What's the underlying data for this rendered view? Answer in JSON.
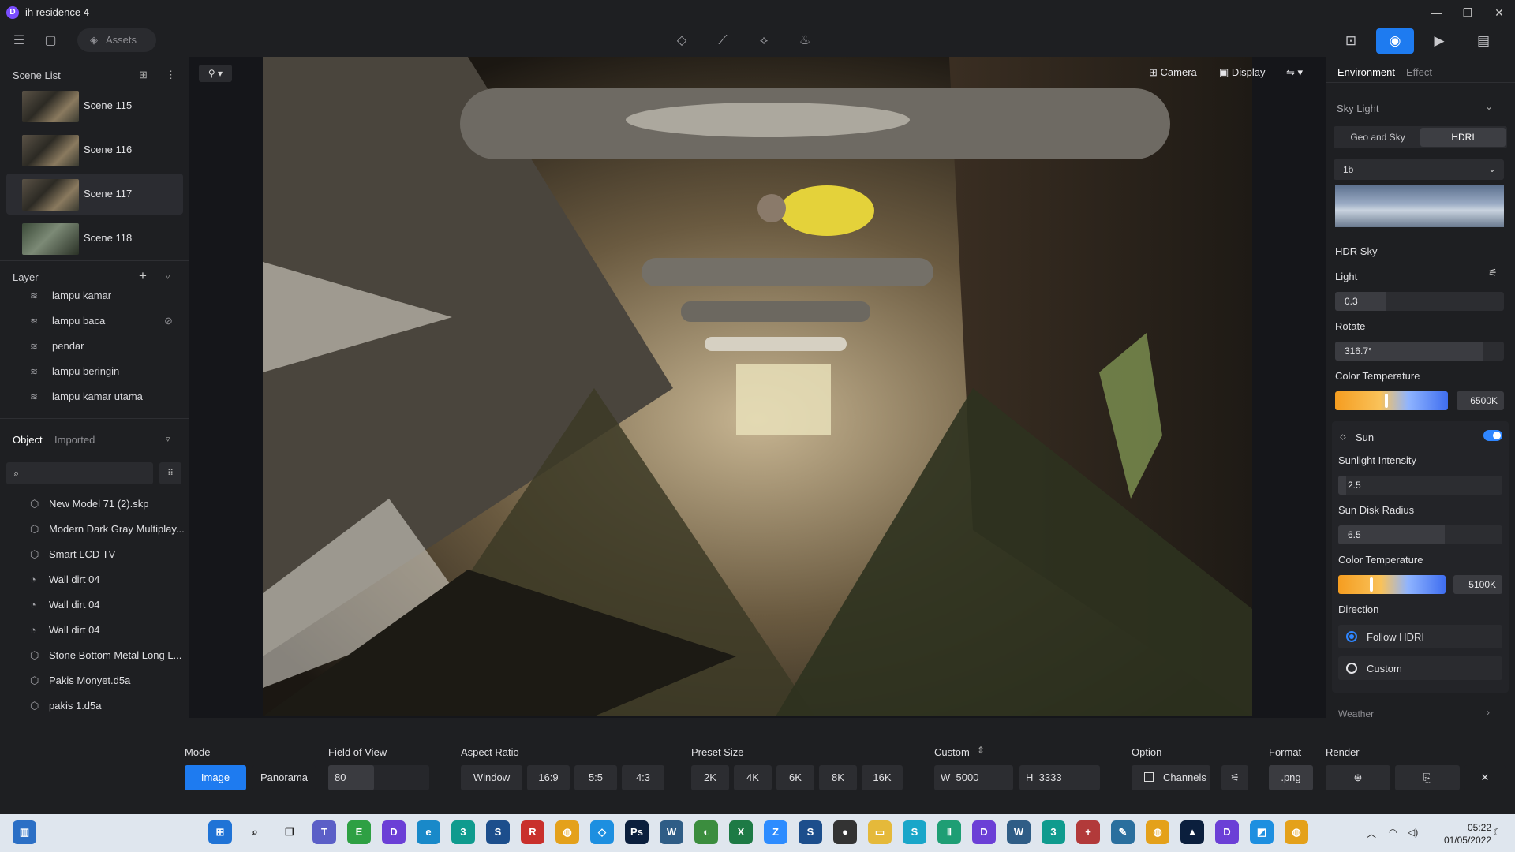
{
  "window": {
    "title": "ih residence 4",
    "app_logo": "D"
  },
  "toolbar": {
    "assets_label": "Assets"
  },
  "right_tabs": [
    "image-camera",
    "photo-camera",
    "video-camera",
    "gallery"
  ],
  "scene_list": {
    "title": "Scene List",
    "items": [
      {
        "label": "Scene 115"
      },
      {
        "label": "Scene 116"
      },
      {
        "label": "Scene 117",
        "selected": true
      },
      {
        "label": "Scene 118"
      }
    ]
  },
  "layer": {
    "title": "Layer",
    "items": [
      "lampu kamar",
      "lampu baca",
      "pendar",
      "lampu beringin",
      "lampu kamar utama"
    ]
  },
  "object": {
    "tab_object": "Object",
    "tab_imported": "Imported",
    "items": [
      "New Model 71 (2).skp",
      "Modern Dark Gray Multiplay...",
      "Smart LCD TV",
      "Wall dirt 04",
      "Wall dirt 04",
      "Wall dirt 04",
      "Stone Bottom Metal Long L...",
      "Pakis Monyet.d5a",
      "pakis 1.d5a"
    ]
  },
  "viewport": {
    "camera_label": "Camera",
    "display_label": "Display"
  },
  "right_panel": {
    "tab_environment": "Environment",
    "tab_effect": "Effect",
    "sky_light_title": "Sky Light",
    "btn_geo": "Geo and Sky",
    "btn_hdri": "HDRI",
    "hdri_select": "1b",
    "hdr_sky": "HDR Sky",
    "light_label": "Light",
    "light_value": "0.3",
    "light_level": 0.3,
    "rotate_label": "Rotate",
    "rotate_value": "316.7°",
    "rotate_level": 0.88,
    "color_temp_label": "Color Temperature",
    "color_temp_value": "6500K",
    "sun_label": "Sun",
    "sun_on": true,
    "sunlight_label": "Sunlight Intensity",
    "sunlight_value": "2.5",
    "sunlight_level": 0.05,
    "sundisk_label": "Sun Disk Radius",
    "sundisk_value": "6.5",
    "sundisk_level": 0.65,
    "sun_color_temp_label": "Color Temperature",
    "sun_color_temp_value": "5100K",
    "direction_label": "Direction",
    "follow_hdri": "Follow HDRI",
    "custom": "Custom",
    "weather": "Weather"
  },
  "bottom": {
    "mode_label": "Mode",
    "mode_image": "Image",
    "mode_panorama": "Panorama",
    "fov_label": "Field of View",
    "fov_value": "80",
    "aspect_label": "Aspect Ratio",
    "aspect_options": [
      "Window",
      "16:9",
      "5:5",
      "4:3"
    ],
    "preset_label": "Preset Size",
    "preset_options": [
      "2K",
      "4K",
      "6K",
      "8K",
      "16K"
    ],
    "custom_label": "Custom",
    "w_label": "W",
    "w_value": "5000",
    "h_label": "H",
    "h_value": "3333",
    "option_label": "Option",
    "channels": "Channels",
    "format_label": "Format",
    "format_value": ".png",
    "render_label": "Render"
  },
  "taskbar": {
    "time": "05:22",
    "date": "01/05/2022"
  }
}
